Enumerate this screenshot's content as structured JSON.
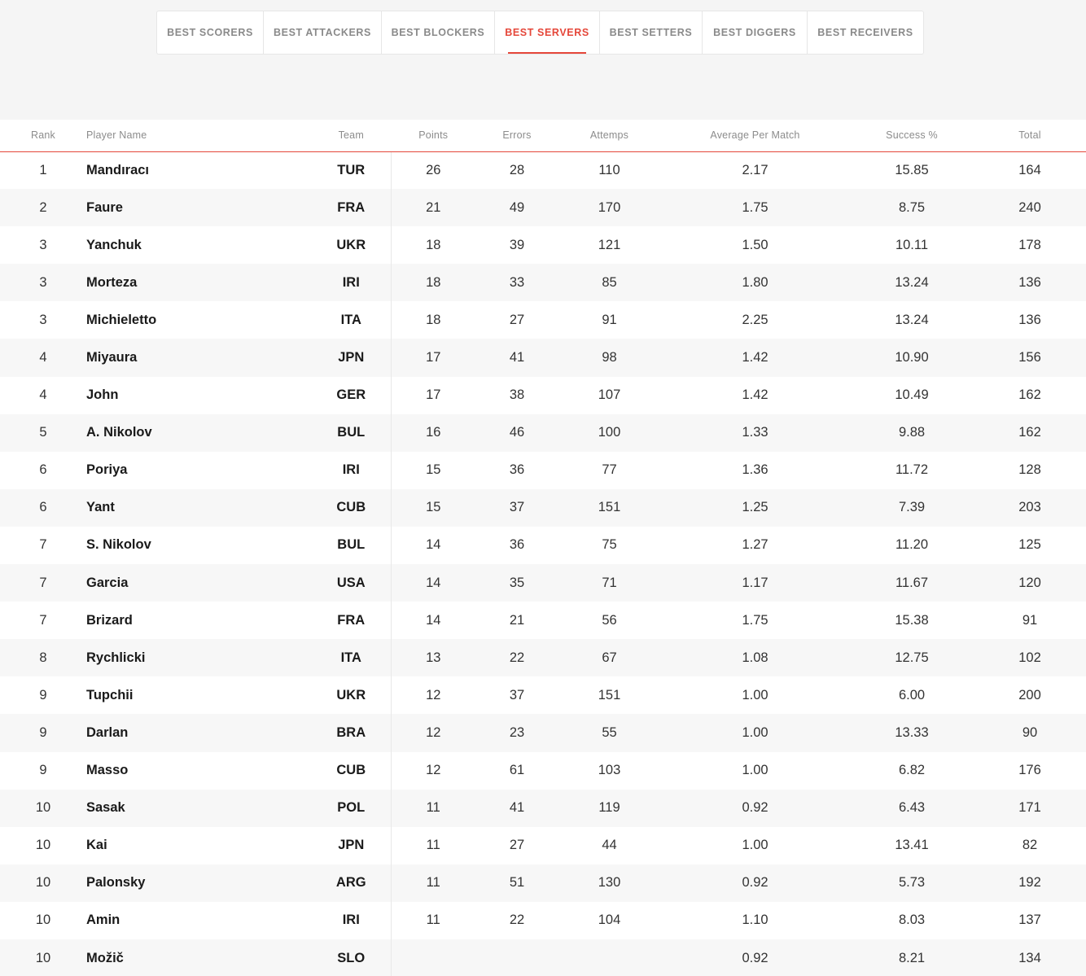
{
  "tabs": [
    {
      "label": "BEST SCORERS",
      "active": false
    },
    {
      "label": "BEST ATTACKERS",
      "active": false
    },
    {
      "label": "BEST BLOCKERS",
      "active": false
    },
    {
      "label": "BEST SERVERS",
      "active": true
    },
    {
      "label": "BEST SETTERS",
      "active": false
    },
    {
      "label": "BEST DIGGERS",
      "active": false
    },
    {
      "label": "BEST RECEIVERS",
      "active": false
    }
  ],
  "table": {
    "headers": {
      "rank": "Rank",
      "player": "Player Name",
      "team": "Team",
      "points": "Points",
      "errors": "Errors",
      "attempts": "Attemps",
      "average": "Average Per Match",
      "success": "Success %",
      "total": "Total"
    },
    "rows": [
      [
        "1",
        "Mandıracı",
        "TUR",
        "26",
        "28",
        "110",
        "2.17",
        "15.85",
        "164"
      ],
      [
        "2",
        "Faure",
        "FRA",
        "21",
        "49",
        "170",
        "1.75",
        "8.75",
        "240"
      ],
      [
        "3",
        "Yanchuk",
        "UKR",
        "18",
        "39",
        "121",
        "1.50",
        "10.11",
        "178"
      ],
      [
        "3",
        "Morteza",
        "IRI",
        "18",
        "33",
        "85",
        "1.80",
        "13.24",
        "136"
      ],
      [
        "3",
        "Michieletto",
        "ITA",
        "18",
        "27",
        "91",
        "2.25",
        "13.24",
        "136"
      ],
      [
        "4",
        "Miyaura",
        "JPN",
        "17",
        "41",
        "98",
        "1.42",
        "10.90",
        "156"
      ],
      [
        "4",
        "John",
        "GER",
        "17",
        "38",
        "107",
        "1.42",
        "10.49",
        "162"
      ],
      [
        "5",
        "A. Nikolov",
        "BUL",
        "16",
        "46",
        "100",
        "1.33",
        "9.88",
        "162"
      ],
      [
        "6",
        "Poriya",
        "IRI",
        "15",
        "36",
        "77",
        "1.36",
        "11.72",
        "128"
      ],
      [
        "6",
        "Yant",
        "CUB",
        "15",
        "37",
        "151",
        "1.25",
        "7.39",
        "203"
      ],
      [
        "7",
        "S. Nikolov",
        "BUL",
        "14",
        "36",
        "75",
        "1.27",
        "11.20",
        "125"
      ],
      [
        "7",
        "Garcia",
        "USA",
        "14",
        "35",
        "71",
        "1.17",
        "11.67",
        "120"
      ],
      [
        "7",
        "Brizard",
        "FRA",
        "14",
        "21",
        "56",
        "1.75",
        "15.38",
        "91"
      ],
      [
        "8",
        "Rychlicki",
        "ITA",
        "13",
        "22",
        "67",
        "1.08",
        "12.75",
        "102"
      ],
      [
        "9",
        "Tupchii",
        "UKR",
        "12",
        "37",
        "151",
        "1.00",
        "6.00",
        "200"
      ],
      [
        "9",
        "Darlan",
        "BRA",
        "12",
        "23",
        "55",
        "1.00",
        "13.33",
        "90"
      ],
      [
        "9",
        "Masso",
        "CUB",
        "12",
        "61",
        "103",
        "1.00",
        "6.82",
        "176"
      ],
      [
        "10",
        "Sasak",
        "POL",
        "11",
        "41",
        "119",
        "0.92",
        "6.43",
        "171"
      ],
      [
        "10",
        "Kai",
        "JPN",
        "11",
        "27",
        "44",
        "1.00",
        "13.41",
        "82"
      ],
      [
        "10",
        "Palonsky",
        "ARG",
        "11",
        "51",
        "130",
        "0.92",
        "5.73",
        "192"
      ],
      [
        "10",
        "Amin",
        "IRI",
        "11",
        "22",
        "104",
        "1.10",
        "8.03",
        "137"
      ],
      [
        "10",
        "Možič",
        "SLO",
        "",
        "",
        "",
        "0.92",
        "8.21",
        "134"
      ]
    ]
  }
}
